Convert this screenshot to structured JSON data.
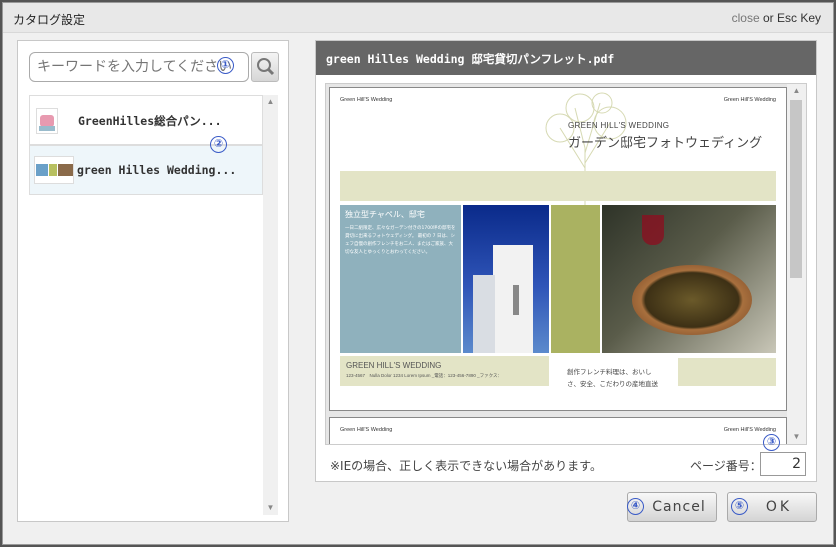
{
  "dialog": {
    "title": "カタログ設定",
    "close_text": "close",
    "or_text": "or",
    "esc_text": "Esc Key"
  },
  "search": {
    "placeholder": "キーワードを入力してください",
    "icon": "magnifier-icon"
  },
  "catalog_list": {
    "items": [
      {
        "label": "GreenHilles総合パン...",
        "selected": false
      },
      {
        "label": "green Hilles Wedding...",
        "selected": true
      }
    ]
  },
  "preview": {
    "file_name": "green Hilles Wedding 邸宅貸切パンフレット.pdf",
    "page": {
      "logo_left": "Green Hill'S Wedding",
      "logo_right": "Green Hill'S Wedding",
      "heading_en": "GREEN HILL'S WEDDING",
      "heading_jp": "ガーデン邸宅フォトウェディング",
      "block_title": "独立型チャペル、邸宅",
      "block_body": "一日二組限定、広々なガーデン付きの1700坪の邸宅を貸切に出来るフォトウェディング。 最初の 7 日は、シェフ自慢の創作フレンチをお二人、またはご家族、大切な友人とゆっくりとおわってください。",
      "caption_title": "GREEN HILL'S WEDDING",
      "caption_sub": "123-4567　Nulla Dolor 1234 Lorem Ipsum _電話：123-456-7890 _ファクス：",
      "caption_right_line1": "創作フレンチ料理は、おいし",
      "caption_right_line2": "さ、安全、こだわりの産地直送"
    },
    "page2_logo_left": "Green Hill'S Wedding",
    "page2_logo_right": "Green Hill'S Wedding"
  },
  "footer": {
    "note": "※IEの場合、正しく表示できない場合があります。",
    "page_label": "ページ番号：",
    "page_number": "2"
  },
  "buttons": {
    "cancel": "Cancel",
    "ok": "OK"
  },
  "badges": [
    "①",
    "②",
    "③",
    "④",
    "⑤"
  ],
  "colors": {
    "header_bar": "#666666",
    "badge": "#3a5bc7",
    "selected_row": "#eef6fa"
  }
}
